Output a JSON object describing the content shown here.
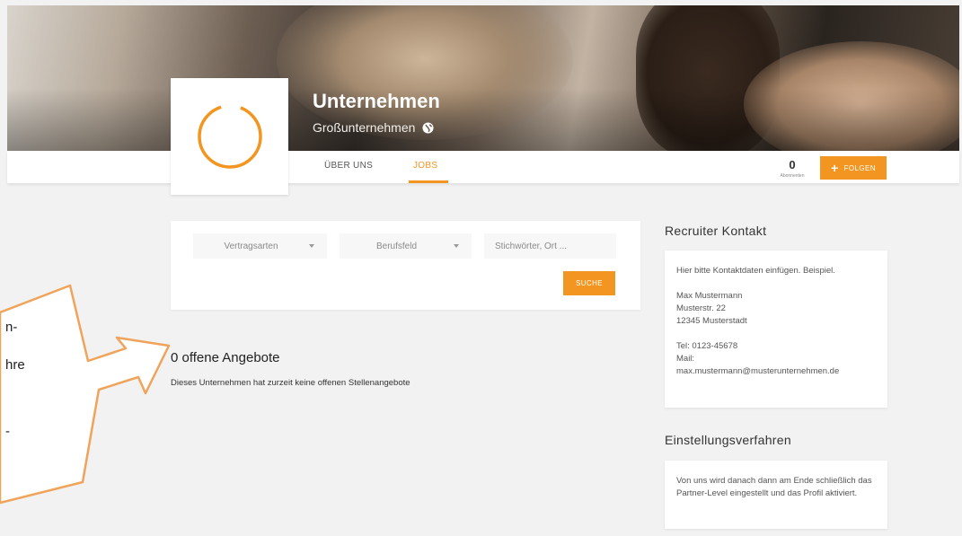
{
  "header": {
    "company_name": "Unternehmen",
    "company_type": "Großunternehmen",
    "globe_icon": "globe-icon"
  },
  "tabs": [
    {
      "label": "ÜBER UNS",
      "active": false
    },
    {
      "label": "JOBS",
      "active": true
    }
  ],
  "follow": {
    "count": "0",
    "count_label": "Abonnenten",
    "button_label": "FOLGEN",
    "button_icon": "plus-icon"
  },
  "search": {
    "contract_select": "Vertragsarten",
    "field_select": "Berufsfeld",
    "keyword_placeholder": "Stichwörter, Ort ...",
    "button_label": "SUCHE"
  },
  "offers": {
    "title": "0 offene Angebote",
    "message": "Dieses Unternehmen hat zurzeit keine offenen Stellenangebote"
  },
  "recruiter": {
    "heading": "Recruiter Kontakt",
    "intro": "Hier bitte Kontaktdaten einfügen. Beispiel.",
    "name": "Max Mustermann",
    "street": "Musterstr. 22",
    "city": "12345 Musterstadt",
    "tel": "Tel: 0123-45678",
    "mail_label": "Mail:",
    "mail": "max.mustermann@musterunternehmen.de"
  },
  "hiring": {
    "heading": "Einstellungsverfahren",
    "text": "Von uns wird danach dann am Ende schließlich das Partner-Level eingestellt und das Profil aktiviert."
  },
  "callout": {
    "line1": "n-",
    "line2": "hre",
    "line3": "-"
  },
  "colors": {
    "accent": "#f39621",
    "callout_border": "#f0a35a"
  }
}
